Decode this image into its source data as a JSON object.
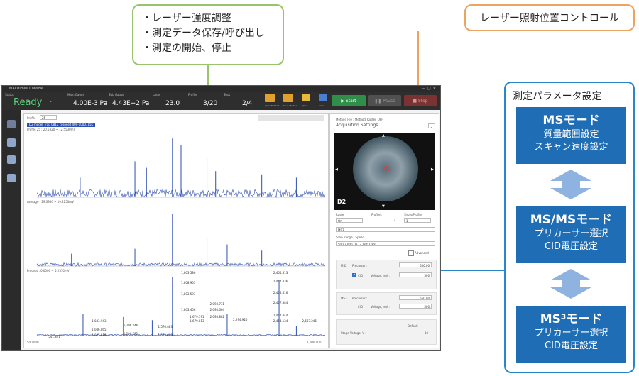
{
  "callouts": {
    "top_center": [
      "・レーザー強度調整",
      "・測定データ保存/呼び出し",
      "・測定の開始、停止"
    ],
    "top_right": "レーザー照射位置コントロール",
    "right_panel_title": "測定パラメータ設定",
    "modes": [
      {
        "title": "MSモード",
        "lines": [
          "質量範囲設定",
          "スキャン速度設定"
        ]
      },
      {
        "title": "MS/MSモード",
        "lines": [
          "プリカーサー選択",
          "CID電圧設定"
        ]
      },
      {
        "title": "MS³モード",
        "lines": [
          "プリカーサー選択",
          "CID電圧設定"
        ]
      }
    ]
  },
  "app": {
    "title": "MALDImini Console",
    "status_label": "Status",
    "status": "Ready",
    "main_gauge_label": "Main Gauge",
    "main_gauge": "4.00E-3 Pa",
    "sub_gauge_label": "Sub Gauge",
    "sub_gauge": "4.43E+2 Pa",
    "laser_label": "Laser",
    "laser": "23.0",
    "profile_label": "Profile",
    "profile": "3/20",
    "shot_label": "Shot",
    "shot": "2/4",
    "buttons": {
      "open_method": "Open Method",
      "save_method": "Save Method",
      "open": "Open",
      "save": "Save",
      "start": "Start",
      "pause": "Pause",
      "stop": "Stop"
    }
  },
  "plot": {
    "profile_label": "Profile",
    "profile_value": "25",
    "tag": "D2 model_Trap 0812_ti.speed 400-1000, 15K",
    "panel1_label": "Profile 25 : 20.5820 ~ 12.5530mV",
    "panel2_label": "Average : 29.3950 ~ 19.2250mV",
    "panel3_label": "Process : 0.0000 ~ 5.2510mV",
    "x_start": "500.000",
    "x_end": "1,000.000",
    "peak_labels": [
      "1,043.943",
      "1,046.865",
      "1,047.919",
      "1,296.246",
      "1,296.782",
      "1,576.863",
      "1,572.688",
      "1,803.586",
      "1,808.953",
      "1,803.593",
      "1,803.456",
      "1,679.591",
      "1,679.813",
      "2,093.731",
      "2,093.664",
      "2,093.862",
      "2,294.920",
      "2,464.813",
      "2,464.836",
      "2,464.816",
      "2,467.884",
      "2,464.844",
      "2,464.134",
      "2,607.246",
      "541.841"
    ]
  },
  "settings": {
    "method_file": "Method File : Method_Raster_OFF",
    "acq_title": "Acquisition Settings",
    "plate_label": "D2",
    "raster_label": "Raster",
    "raster_value": "On",
    "profiles_label": "Profiles",
    "profiles_value": "4",
    "shots_label": "Shots/Profile",
    "shots_value": "1",
    "mode": "MS3",
    "scan_label": "Scan Range , Speed",
    "scan_value": "500-3,000 Da , 4,000 Da/s",
    "advanced": "Advanced",
    "ms2_label": "MS2",
    "ms3_label": "MS3",
    "precursor_label": "Precursor :",
    "cid_label": "CID",
    "voltage_label": "Voltage, mV :",
    "ms2_precursor": "650.00",
    "ms2_voltage": "500",
    "ms3_precursor": "650.00",
    "ms3_voltage": "500",
    "default_label": "Default",
    "stage_voltage_label": "Stage Voltage, V :",
    "stage_voltage": "10"
  }
}
